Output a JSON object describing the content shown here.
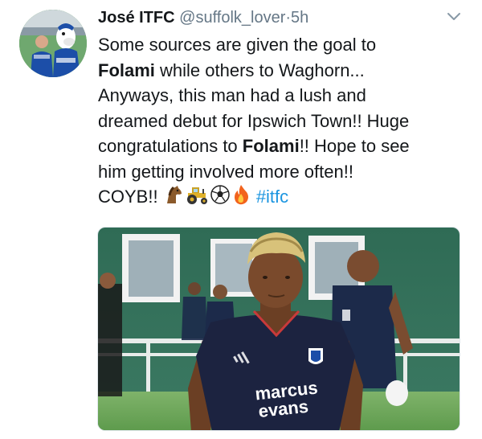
{
  "tweet": {
    "author_name": "José ITFC",
    "handle": "@suffolk_lover",
    "separator": "·",
    "time": "5h",
    "lines": [
      {
        "pre": "Some sources are given the goal to",
        "bold": "",
        "post": ""
      },
      {
        "pre": "",
        "bold": "Folami",
        "post": " while others to Waghorn..."
      },
      {
        "pre": "Anyways, this man had a lush and",
        "bold": "",
        "post": ""
      },
      {
        "pre": "dreamed debut for Ipswich Town!! Huge",
        "bold": "",
        "post": ""
      },
      {
        "pre": "congratulations to ",
        "bold": "Folami",
        "post": "!! Hope to see"
      },
      {
        "pre": "him getting involved more often!!",
        "bold": "",
        "post": ""
      }
    ],
    "last_line_text": "COYB!! ",
    "hashtag": "#itfc",
    "emojis": [
      "horse-emoji",
      "tractor-emoji",
      "soccer-ball-emoji",
      "fire-emoji"
    ],
    "media": {
      "shirt_sponsor_line1": "marcus",
      "shirt_sponsor_line2": "evans"
    }
  },
  "colors": {
    "text": "#14171a",
    "secondary": "#657786",
    "link": "#1b95e0",
    "shirt_navy": "#1c2340"
  }
}
